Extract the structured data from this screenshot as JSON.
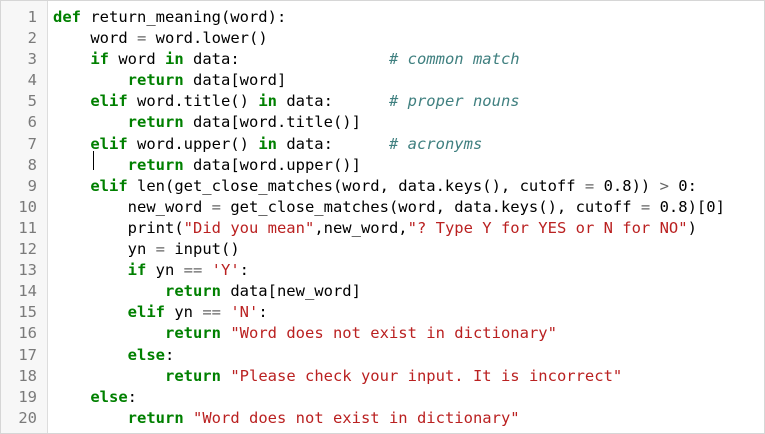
{
  "editor": {
    "lines": [
      {
        "n": "1",
        "tokens": [
          {
            "t": "def",
            "c": "kw"
          },
          {
            "t": " return_meaning(word):",
            "c": ""
          }
        ]
      },
      {
        "n": "2",
        "tokens": [
          {
            "t": "    word ",
            "c": ""
          },
          {
            "t": "=",
            "c": "op"
          },
          {
            "t": " word.lower()",
            "c": ""
          }
        ]
      },
      {
        "n": "3",
        "tokens": [
          {
            "t": "    ",
            "c": ""
          },
          {
            "t": "if",
            "c": "kw"
          },
          {
            "t": " word ",
            "c": ""
          },
          {
            "t": "in",
            "c": "kw"
          },
          {
            "t": " data:                ",
            "c": ""
          },
          {
            "t": "# common match",
            "c": "cm"
          }
        ]
      },
      {
        "n": "4",
        "tokens": [
          {
            "t": "        ",
            "c": ""
          },
          {
            "t": "return",
            "c": "kw"
          },
          {
            "t": " data[word]",
            "c": ""
          }
        ]
      },
      {
        "n": "5",
        "tokens": [
          {
            "t": "    ",
            "c": ""
          },
          {
            "t": "elif",
            "c": "kw"
          },
          {
            "t": " word.title() ",
            "c": ""
          },
          {
            "t": "in",
            "c": "kw"
          },
          {
            "t": " data:      ",
            "c": ""
          },
          {
            "t": "# proper nouns",
            "c": "cm"
          }
        ]
      },
      {
        "n": "6",
        "tokens": [
          {
            "t": "        ",
            "c": ""
          },
          {
            "t": "return",
            "c": "kw"
          },
          {
            "t": " data[word.title()]",
            "c": ""
          }
        ]
      },
      {
        "n": "7",
        "tokens": [
          {
            "t": "    ",
            "c": ""
          },
          {
            "t": "elif",
            "c": "kw"
          },
          {
            "t": " word.upper() ",
            "c": ""
          },
          {
            "t": "in",
            "c": "kw"
          },
          {
            "t": " data:      ",
            "c": ""
          },
          {
            "t": "# acronyms",
            "c": "cm"
          }
        ]
      },
      {
        "n": "8",
        "tokens": [
          {
            "t": "        ",
            "c": ""
          },
          {
            "t": "return",
            "c": "kw"
          },
          {
            "t": " data[word.upper()]",
            "c": ""
          }
        ]
      },
      {
        "n": "9",
        "tokens": [
          {
            "t": "    ",
            "c": ""
          },
          {
            "t": "elif",
            "c": "kw"
          },
          {
            "t": " len(get_close_matches(word, data.keys(), cutoff ",
            "c": ""
          },
          {
            "t": "=",
            "c": "op"
          },
          {
            "t": " 0.8)) ",
            "c": ""
          },
          {
            "t": ">",
            "c": "op"
          },
          {
            "t": " 0:",
            "c": ""
          }
        ]
      },
      {
        "n": "10",
        "tokens": [
          {
            "t": "        new_word ",
            "c": ""
          },
          {
            "t": "=",
            "c": "op"
          },
          {
            "t": " get_close_matches(word, data.keys(), cutoff ",
            "c": ""
          },
          {
            "t": "=",
            "c": "op"
          },
          {
            "t": " 0.8)[0]",
            "c": ""
          }
        ]
      },
      {
        "n": "11",
        "tokens": [
          {
            "t": "        print(",
            "c": ""
          },
          {
            "t": "\"Did you mean\"",
            "c": "str"
          },
          {
            "t": ",new_word,",
            "c": ""
          },
          {
            "t": "\"? Type Y for YES or N for NO\"",
            "c": "str"
          },
          {
            "t": ")",
            "c": ""
          }
        ]
      },
      {
        "n": "12",
        "tokens": [
          {
            "t": "        yn ",
            "c": ""
          },
          {
            "t": "=",
            "c": "op"
          },
          {
            "t": " input()",
            "c": ""
          }
        ]
      },
      {
        "n": "13",
        "tokens": [
          {
            "t": "        ",
            "c": ""
          },
          {
            "t": "if",
            "c": "kw"
          },
          {
            "t": " yn ",
            "c": ""
          },
          {
            "t": "==",
            "c": "op"
          },
          {
            "t": " ",
            "c": ""
          },
          {
            "t": "'Y'",
            "c": "str"
          },
          {
            "t": ":",
            "c": ""
          }
        ]
      },
      {
        "n": "14",
        "tokens": [
          {
            "t": "            ",
            "c": ""
          },
          {
            "t": "return",
            "c": "kw"
          },
          {
            "t": " data[new_word]",
            "c": ""
          }
        ]
      },
      {
        "n": "15",
        "tokens": [
          {
            "t": "        ",
            "c": ""
          },
          {
            "t": "elif",
            "c": "kw"
          },
          {
            "t": " yn ",
            "c": ""
          },
          {
            "t": "==",
            "c": "op"
          },
          {
            "t": " ",
            "c": ""
          },
          {
            "t": "'N'",
            "c": "str"
          },
          {
            "t": ":",
            "c": ""
          }
        ]
      },
      {
        "n": "16",
        "tokens": [
          {
            "t": "            ",
            "c": ""
          },
          {
            "t": "return",
            "c": "kw"
          },
          {
            "t": " ",
            "c": ""
          },
          {
            "t": "\"Word does not exist in dictionary\"",
            "c": "str"
          }
        ]
      },
      {
        "n": "17",
        "tokens": [
          {
            "t": "        ",
            "c": ""
          },
          {
            "t": "else",
            "c": "kw"
          },
          {
            "t": ":",
            "c": ""
          }
        ]
      },
      {
        "n": "18",
        "tokens": [
          {
            "t": "            ",
            "c": ""
          },
          {
            "t": "return",
            "c": "kw"
          },
          {
            "t": " ",
            "c": ""
          },
          {
            "t": "\"Please check your input. It is incorrect\"",
            "c": "str"
          }
        ]
      },
      {
        "n": "19",
        "tokens": [
          {
            "t": "    ",
            "c": ""
          },
          {
            "t": "else",
            "c": "kw"
          },
          {
            "t": ":",
            "c": ""
          }
        ]
      },
      {
        "n": "20",
        "tokens": [
          {
            "t": "        ",
            "c": ""
          },
          {
            "t": "return",
            "c": "kw"
          },
          {
            "t": " ",
            "c": ""
          },
          {
            "t": "\"Word does not exist in dictionary\"",
            "c": "str"
          }
        ]
      }
    ]
  }
}
